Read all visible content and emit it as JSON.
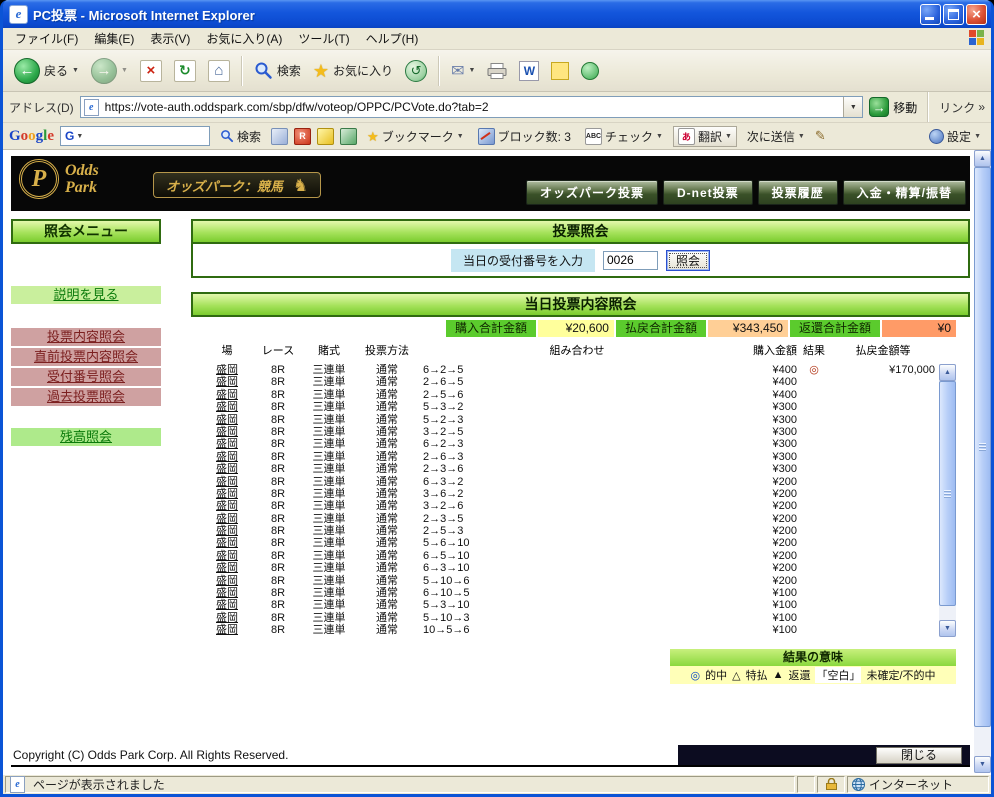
{
  "window": {
    "title": "PC投票 - Microsoft Internet Explorer"
  },
  "menu": {
    "items": [
      "ファイル(F)",
      "編集(E)",
      "表示(V)",
      "お気に入り(A)",
      "ツール(T)",
      "ヘルプ(H)"
    ]
  },
  "toolbar": {
    "back": "戻る",
    "search": "検索",
    "favorites": "お気に入り"
  },
  "address": {
    "label": "アドレス(D)",
    "url": "https://vote-auth.oddspark.com/sbp/dfw/voteop/OPPC/PCVote.do?tab=2",
    "go": "移動",
    "links": "リンク"
  },
  "google": {
    "logo_letters": [
      "G",
      "o",
      "o",
      "g",
      "l",
      "e"
    ],
    "search": "検索",
    "bookmarks": "ブックマーク",
    "blocked": "ブロック数: 3",
    "check": "チェック",
    "translate": "翻訳",
    "send_to": "次に送信",
    "settings": "設定"
  },
  "site": {
    "logo_line1": "Odds",
    "logo_line2": "Park",
    "logo_initial": "P",
    "badge": "オッズパーク：競馬",
    "nav": [
      "オッズパーク投票",
      "D-net投票",
      "投票履歴",
      "入金・精算/振替"
    ]
  },
  "sidebar": {
    "title": "照会メニュー",
    "items": [
      {
        "label": "説明を見る"
      },
      {
        "label": "投票内容照会"
      },
      {
        "label": "直前投票内容照会"
      },
      {
        "label": "受付番号照会"
      },
      {
        "label": "過去投票照会"
      },
      {
        "label": "残高照会"
      }
    ]
  },
  "inquiry": {
    "title": "投票照会",
    "receipt_label": "当日の受付番号を入力",
    "receipt_value": "0026",
    "submit": "照会"
  },
  "today": {
    "title": "当日投票内容照会",
    "summary": [
      {
        "label": "購入合計金額",
        "value": "¥20,600"
      },
      {
        "label": "払戻合計金額",
        "value": "¥343,450"
      },
      {
        "label": "返還合計金額",
        "value": "¥0"
      }
    ],
    "columns": [
      "場",
      "レース",
      "賭式",
      "投票方法",
      "組み合わせ",
      "購入金額",
      "結果",
      "払戻金額等"
    ],
    "rows": [
      {
        "venue": "盛岡",
        "race": "8R",
        "bet": "三連単",
        "method": "通常",
        "combo": "6→2→5",
        "amount": "¥400",
        "result": "◎",
        "payout": "¥170,000"
      },
      {
        "venue": "盛岡",
        "race": "8R",
        "bet": "三連単",
        "method": "通常",
        "combo": "2→6→5",
        "amount": "¥400",
        "result": "",
        "payout": ""
      },
      {
        "venue": "盛岡",
        "race": "8R",
        "bet": "三連単",
        "method": "通常",
        "combo": "2→5→6",
        "amount": "¥400",
        "result": "",
        "payout": ""
      },
      {
        "venue": "盛岡",
        "race": "8R",
        "bet": "三連単",
        "method": "通常",
        "combo": "5→3→2",
        "amount": "¥300",
        "result": "",
        "payout": ""
      },
      {
        "venue": "盛岡",
        "race": "8R",
        "bet": "三連単",
        "method": "通常",
        "combo": "5→2→3",
        "amount": "¥300",
        "result": "",
        "payout": ""
      },
      {
        "venue": "盛岡",
        "race": "8R",
        "bet": "三連単",
        "method": "通常",
        "combo": "3→2→5",
        "amount": "¥300",
        "result": "",
        "payout": ""
      },
      {
        "venue": "盛岡",
        "race": "8R",
        "bet": "三連単",
        "method": "通常",
        "combo": "6→2→3",
        "amount": "¥300",
        "result": "",
        "payout": ""
      },
      {
        "venue": "盛岡",
        "race": "8R",
        "bet": "三連単",
        "method": "通常",
        "combo": "2→6→3",
        "amount": "¥300",
        "result": "",
        "payout": ""
      },
      {
        "venue": "盛岡",
        "race": "8R",
        "bet": "三連単",
        "method": "通常",
        "combo": "2→3→6",
        "amount": "¥300",
        "result": "",
        "payout": ""
      },
      {
        "venue": "盛岡",
        "race": "8R",
        "bet": "三連単",
        "method": "通常",
        "combo": "6→3→2",
        "amount": "¥200",
        "result": "",
        "payout": ""
      },
      {
        "venue": "盛岡",
        "race": "8R",
        "bet": "三連単",
        "method": "通常",
        "combo": "3→6→2",
        "amount": "¥200",
        "result": "",
        "payout": ""
      },
      {
        "venue": "盛岡",
        "race": "8R",
        "bet": "三連単",
        "method": "通常",
        "combo": "3→2→6",
        "amount": "¥200",
        "result": "",
        "payout": ""
      },
      {
        "venue": "盛岡",
        "race": "8R",
        "bet": "三連単",
        "method": "通常",
        "combo": "2→3→5",
        "amount": "¥200",
        "result": "",
        "payout": ""
      },
      {
        "venue": "盛岡",
        "race": "8R",
        "bet": "三連単",
        "method": "通常",
        "combo": "2→5→3",
        "amount": "¥200",
        "result": "",
        "payout": ""
      },
      {
        "venue": "盛岡",
        "race": "8R",
        "bet": "三連単",
        "method": "通常",
        "combo": "5→6→10",
        "amount": "¥200",
        "result": "",
        "payout": ""
      },
      {
        "venue": "盛岡",
        "race": "8R",
        "bet": "三連単",
        "method": "通常",
        "combo": "6→5→10",
        "amount": "¥200",
        "result": "",
        "payout": ""
      },
      {
        "venue": "盛岡",
        "race": "8R",
        "bet": "三連単",
        "method": "通常",
        "combo": "6→3→10",
        "amount": "¥200",
        "result": "",
        "payout": ""
      },
      {
        "venue": "盛岡",
        "race": "8R",
        "bet": "三連単",
        "method": "通常",
        "combo": "5→10→6",
        "amount": "¥200",
        "result": "",
        "payout": ""
      },
      {
        "venue": "盛岡",
        "race": "8R",
        "bet": "三連単",
        "method": "通常",
        "combo": "6→10→5",
        "amount": "¥100",
        "result": "",
        "payout": ""
      },
      {
        "venue": "盛岡",
        "race": "8R",
        "bet": "三連単",
        "method": "通常",
        "combo": "5→3→10",
        "amount": "¥100",
        "result": "",
        "payout": ""
      },
      {
        "venue": "盛岡",
        "race": "8R",
        "bet": "三連単",
        "method": "通常",
        "combo": "5→10→3",
        "amount": "¥100",
        "result": "",
        "payout": ""
      },
      {
        "venue": "盛岡",
        "race": "8R",
        "bet": "三連単",
        "method": "通常",
        "combo": "10→5→6",
        "amount": "¥100",
        "result": "",
        "payout": ""
      }
    ],
    "legend_title": "結果の意味",
    "legend": [
      {
        "symbol": "◎",
        "label": "的中"
      },
      {
        "symbol": "△",
        "label": "特払"
      },
      {
        "symbol": "▲",
        "label": "返還"
      },
      {
        "symbol": "「空白」",
        "label": "未確定/不的中"
      }
    ]
  },
  "footer": {
    "copyright": "Copyright (C) Odds Park Corp. All Rights Reserved.",
    "close": "閉じる"
  },
  "status": {
    "message": "ページが表示されました",
    "zone": "インターネット"
  },
  "icons": {
    "back_arrow": "←",
    "forward_arrow": "→",
    "stop_x": "×",
    "refresh": "↻",
    "home": "⌂",
    "dropdown": "▼",
    "mail": "✉",
    "star": "★",
    "pen": "✎",
    "go_arrow": "→",
    "links_chevron": "»",
    "horse": "♞",
    "check": "✓",
    "abc": "ABC",
    "translate_glyph": "あ",
    "browser_e": "e",
    "word_w": "W",
    "google_g": "G",
    "close_x": "×",
    "rank_r": "R",
    "history": "↺",
    "clock_dot": "·"
  }
}
